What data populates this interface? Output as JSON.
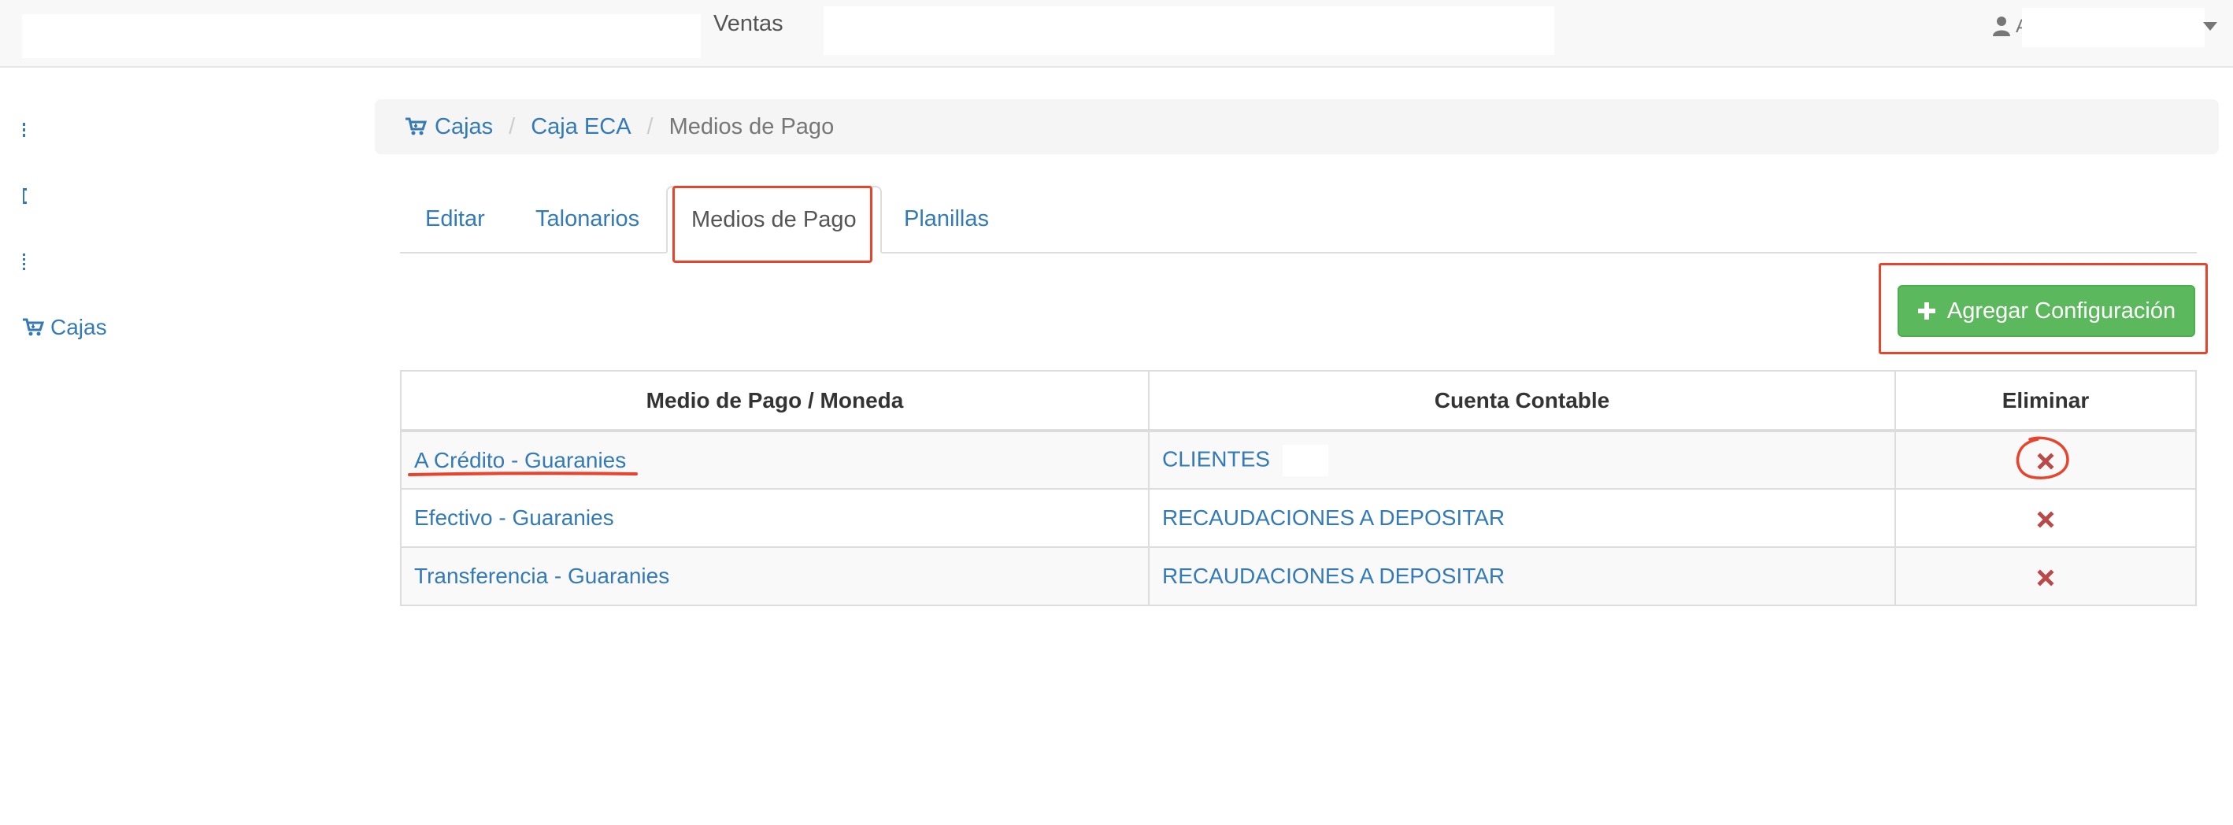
{
  "topbar": {
    "nav_ventas": "Ventas",
    "user_initial": "A"
  },
  "sidebar": {
    "cajas_label": "Cajas"
  },
  "breadcrumb": {
    "items": [
      "Cajas",
      "Caja ECA",
      "Medios de Pago"
    ],
    "separator": "/"
  },
  "tabs": [
    "Editar",
    "Talonarios",
    "Medios de Pago",
    "Planillas"
  ],
  "active_tab": "Medios de Pago",
  "add_button": {
    "icon": "plus-icon",
    "label": "Agregar Configuración"
  },
  "table": {
    "headers": [
      "Medio de Pago / Moneda",
      "Cuenta Contable",
      "Eliminar"
    ],
    "rows": [
      {
        "medio": "A Crédito - Guaranies",
        "cuenta": "CLIENTES",
        "delete_icon": "remove-icon"
      },
      {
        "medio": "Efectivo - Guaranies",
        "cuenta": "RECAUDACIONES A DEPOSITAR",
        "delete_icon": "remove-icon"
      },
      {
        "medio": "Transferencia - Guaranies",
        "cuenta": "RECAUDACIONES A DEPOSITAR",
        "delete_icon": "remove-icon"
      }
    ]
  },
  "colors": {
    "link": "#337ab7",
    "button_green": "#5cb85c",
    "delete_red": "#b94a48",
    "annotation_red": "#e8432c"
  }
}
